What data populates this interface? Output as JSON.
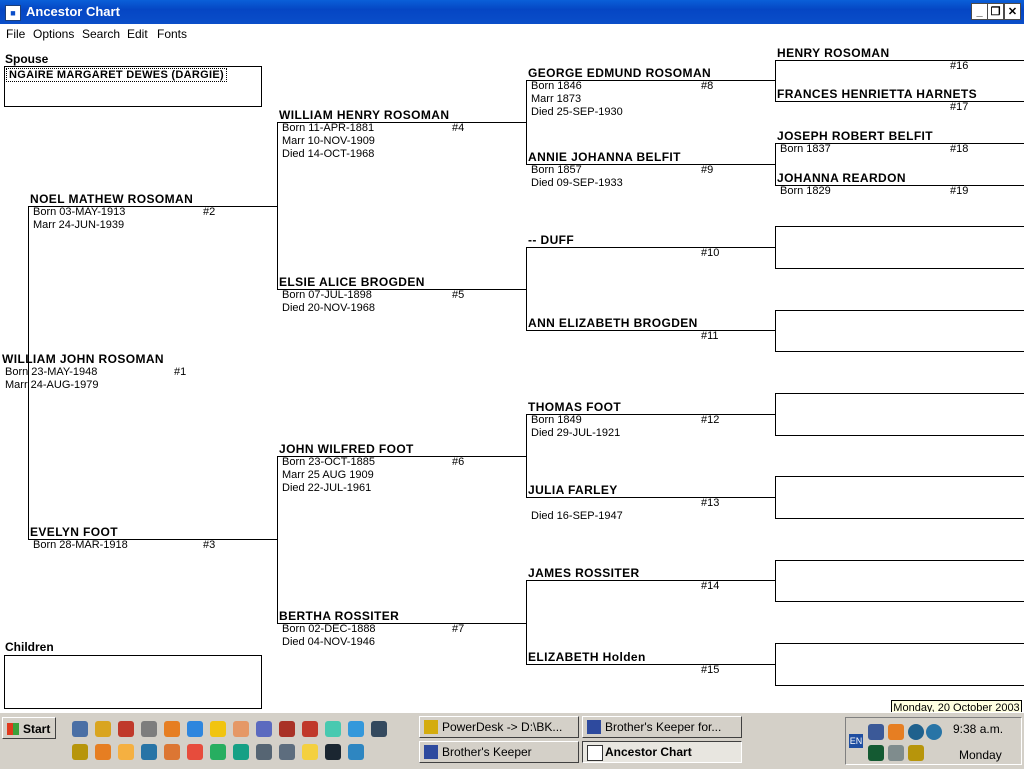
{
  "window": {
    "title": "Ancestor Chart"
  },
  "menu": [
    "File",
    "Options",
    "Search",
    "Edit",
    "Fonts"
  ],
  "spouse": {
    "label": "Spouse",
    "name": "NGAIRE MARGARET  DEWES (DARGIE)"
  },
  "children": {
    "label": "Children"
  },
  "persons": {
    "p1": {
      "name": "WILLIAM JOHN ROSOMAN",
      "num": "#1",
      "details": "Born 23-MAY-1948\nMarr 24-AUG-1979"
    },
    "p2": {
      "name": "NOEL MATHEW ROSOMAN",
      "num": "#2",
      "details": "Born 03-MAY-1913\nMarr 24-JUN-1939"
    },
    "p3": {
      "name": "EVELYN FOOT",
      "num": "#3",
      "details": "Born 28-MAR-1918"
    },
    "p4": {
      "name": "WILLIAM HENRY ROSOMAN",
      "num": "#4",
      "details": "Born 11-APR-1881\nMarr 10-NOV-1909\nDied 14-OCT-1968"
    },
    "p5": {
      "name": "ELSIE ALICE BROGDEN",
      "num": "#5",
      "details": "Born 07-JUL-1898\nDied 20-NOV-1968"
    },
    "p6": {
      "name": "JOHN WILFRED FOOT",
      "num": "#6",
      "details": "Born 23-OCT-1885\nMarr 25 AUG 1909\nDied 22-JUL-1961"
    },
    "p7": {
      "name": "BERTHA ROSSITER",
      "num": "#7",
      "details": "Born 02-DEC-1888\nDied 04-NOV-1946"
    },
    "p8": {
      "name": "GEORGE EDMUND ROSOMAN",
      "num": "#8",
      "details": "Born 1846\nMarr 1873\nDied 25-SEP-1930"
    },
    "p9": {
      "name": "ANNIE JOHANNA BELFIT",
      "num": "#9",
      "details": "Born 1857\nDied 09-SEP-1933"
    },
    "p10": {
      "name": "-- DUFF",
      "num": "#10",
      "details": ""
    },
    "p11": {
      "name": "ANN ELIZABETH BROGDEN",
      "num": "#11",
      "details": ""
    },
    "p12": {
      "name": "THOMAS FOOT",
      "num": "#12",
      "details": "Born 1849\nDied 29-JUL-1921"
    },
    "p13": {
      "name": "JULIA FARLEY",
      "num": "#13",
      "details": "\nDied 16-SEP-1947"
    },
    "p14": {
      "name": "JAMES ROSSITER",
      "num": "#14",
      "details": ""
    },
    "p15": {
      "name": "ELIZABETH Holden",
      "num": "#15",
      "details": ""
    },
    "p16": {
      "name": "HENRY ROSOMAN",
      "num": "#16",
      "details": ""
    },
    "p17": {
      "name": "FRANCES HENRIETTA HARNETS",
      "num": "#17",
      "details": ""
    },
    "p18": {
      "name": "JOSEPH ROBERT BELFIT",
      "num": "#18",
      "details": "Born 1837"
    },
    "p19": {
      "name": "JOHANNA REARDON",
      "num": "#19",
      "details": "Born 1829"
    }
  },
  "taskbar": {
    "start_label": "Start",
    "tasks": [
      {
        "label": "PowerDesk -> D:\\BK..."
      },
      {
        "label": "Brother's Keeper for..."
      },
      {
        "label": "Brother's Keeper"
      },
      {
        "label": "Ancestor Chart"
      }
    ],
    "language": "EN",
    "time": "9:38 a.m.",
    "day": "Monday",
    "tooltip": "Monday, 20 October 2003"
  },
  "colors": {
    "titlebar": "#0546c4",
    "taskbar": "#d4d0c8",
    "tooltip": "#ffffe1"
  }
}
